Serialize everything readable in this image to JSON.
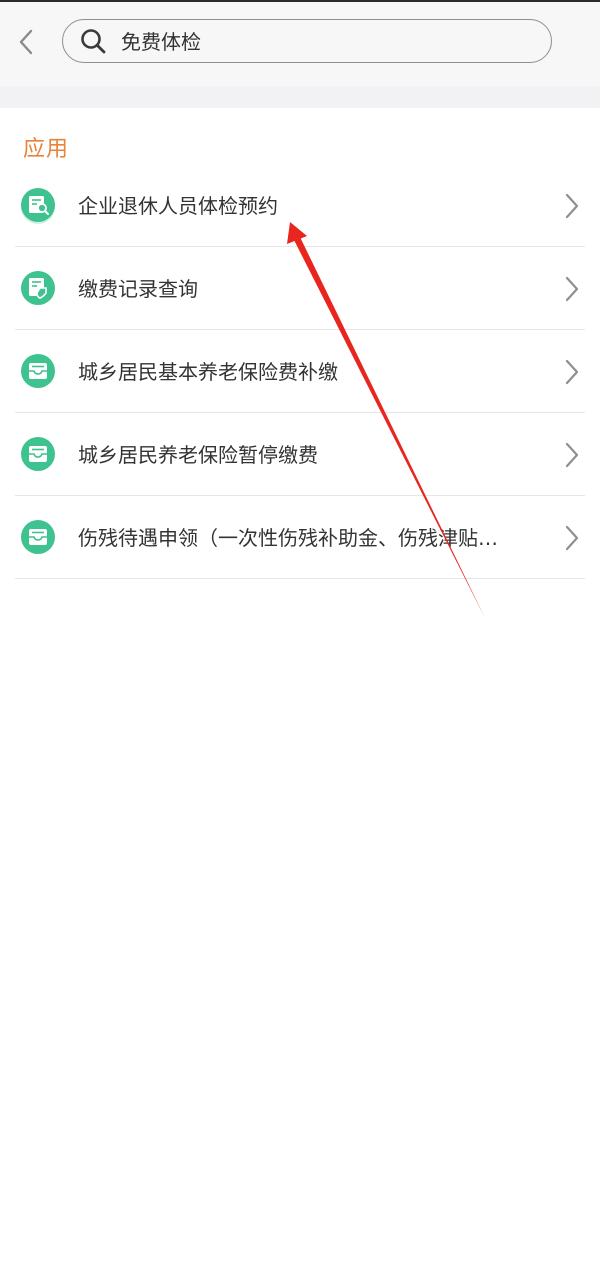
{
  "header": {
    "back_icon": "chevron-left-icon",
    "search": {
      "icon": "search-icon",
      "value": "免费体检"
    }
  },
  "section": {
    "title": "应用"
  },
  "results": [
    {
      "label": "企业退休人员体检预约",
      "icon": "document-search-icon"
    },
    {
      "label": "缴费记录查询",
      "icon": "document-shield-icon"
    },
    {
      "label": "城乡居民基本养老保险费补缴",
      "icon": "inbox-icon"
    },
    {
      "label": "城乡居民养老保险暂停缴费",
      "icon": "inbox-icon"
    },
    {
      "label": "伤残待遇申领（一次性伤残补助金、伤残津贴…",
      "icon": "inbox-icon"
    }
  ],
  "colors": {
    "accent_orange": "#e8833a",
    "icon_green": "#3ec28f",
    "annotation_red": "#e8261f"
  }
}
